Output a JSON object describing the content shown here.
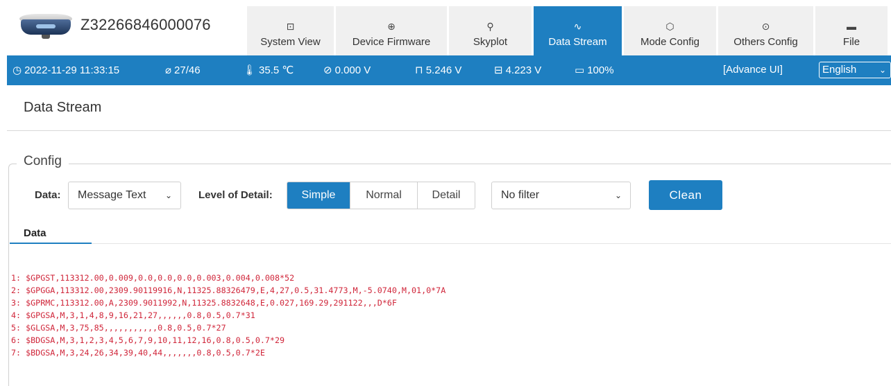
{
  "device": {
    "id": "Z32266846000076",
    "icon": "gnss-receiver-icon"
  },
  "tabs": [
    {
      "label": "System View",
      "icon": "monitor-icon",
      "glyph": "⊡",
      "active": false
    },
    {
      "label": "Device Firmware",
      "icon": "firmware-icon",
      "glyph": "⊕",
      "active": false
    },
    {
      "label": "Skyplot",
      "icon": "satellite-icon",
      "glyph": "⚲",
      "active": false
    },
    {
      "label": "Data Stream",
      "icon": "wave-icon",
      "glyph": "∿",
      "active": true
    },
    {
      "label": "Mode Config",
      "icon": "cube-icon",
      "glyph": "⬡",
      "active": false
    },
    {
      "label": "Others Config",
      "icon": "ellipsis-circle-icon",
      "glyph": "⊙",
      "active": false
    },
    {
      "label": "File",
      "icon": "folder-icon",
      "glyph": "▬",
      "active": false
    }
  ],
  "status": {
    "datetime": "2022-11-29 11:33:15",
    "satellites": "27/46",
    "temperature": "35.5 ℃",
    "voltage_ext": "0.000 V",
    "voltage_usb": "5.246 V",
    "voltage_batt": "4.223 V",
    "battery": "100%",
    "advance_ui": "[Advance UI]",
    "language": "English"
  },
  "page": {
    "title": "Data Stream"
  },
  "config": {
    "legend": "Config",
    "data_label": "Data:",
    "data_value": "Message Text",
    "detail_label": "Level of Detail:",
    "detail_options": [
      "Simple",
      "Normal",
      "Detail"
    ],
    "detail_selected": "Simple",
    "filter_value": "No filter",
    "clean_label": "Clean"
  },
  "data_tab": {
    "label": "Data"
  },
  "stream_lines": [
    "1: $GPGST,113312.00,0.009,0.0,0.0,0.0,0.003,0.004,0.008*52",
    "2: $GPGGA,113312.00,2309.90119916,N,11325.88326479,E,4,27,0.5,31.4773,M,-5.0740,M,01,0*7A",
    "3: $GPRMC,113312.00,A,2309.9011992,N,11325.8832648,E,0.027,169.29,291122,,,D*6F",
    "4: $GPGSA,M,3,1,4,8,9,16,21,27,,,,,,0.8,0.5,0.7*31",
    "5: $GLGSA,M,3,75,85,,,,,,,,,,,0.8,0.5,0.7*27",
    "6: $BDGSA,M,3,1,2,3,4,5,6,7,9,10,11,12,16,0.8,0.5,0.7*29",
    "7: $BDGSA,M,3,24,26,34,39,40,44,,,,,,,0.8,0.5,0.7*2E"
  ],
  "colors": {
    "accent": "#1e7fc1",
    "stream_text": "#d0263a"
  }
}
